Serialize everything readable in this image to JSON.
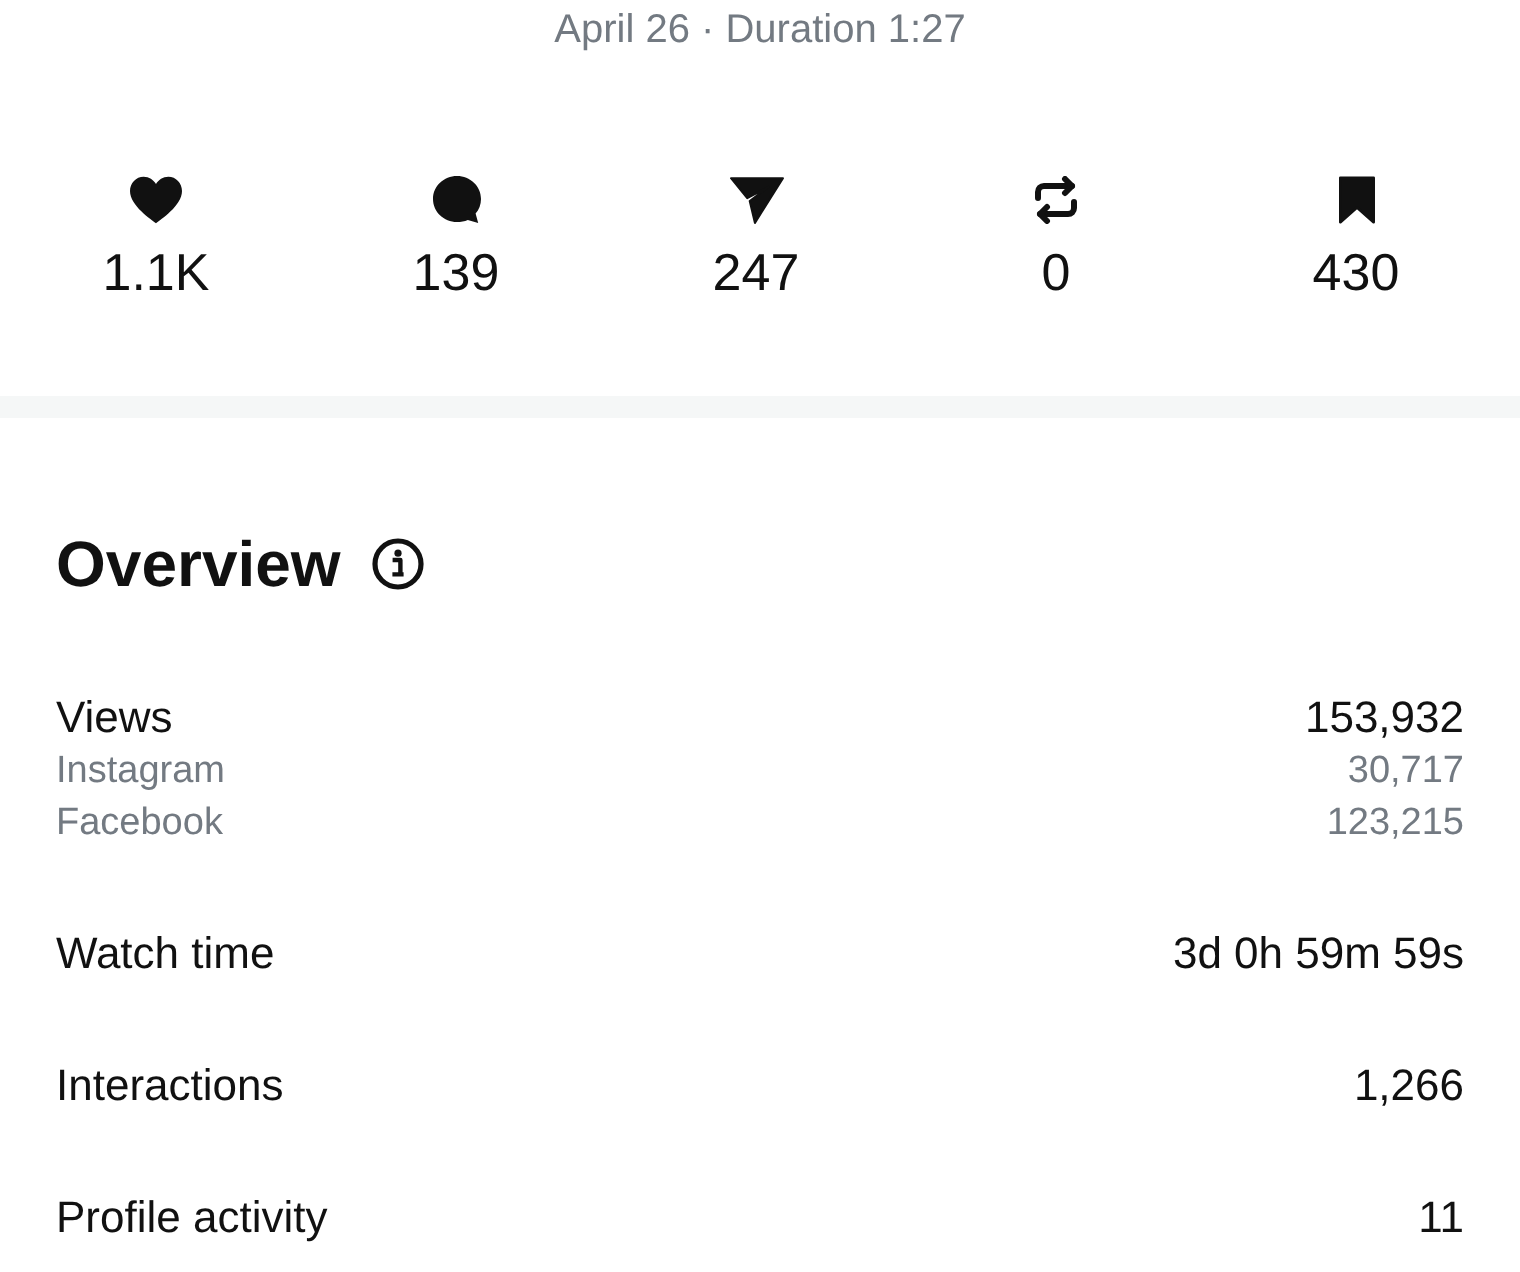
{
  "header": {
    "date_line": "April 26 · Duration 1:27"
  },
  "stats": [
    {
      "kind": "heart",
      "value": "1.1K"
    },
    {
      "kind": "comment",
      "value": "139"
    },
    {
      "kind": "send",
      "value": "247"
    },
    {
      "kind": "repost",
      "value": "0"
    },
    {
      "kind": "bookmark",
      "value": "430"
    }
  ],
  "overview": {
    "title": "Overview",
    "metrics": [
      {
        "label": "Views",
        "value": "153,932",
        "breakdown": [
          {
            "label": "Instagram",
            "value": "30,717"
          },
          {
            "label": "Facebook",
            "value": "123,215"
          }
        ]
      },
      {
        "label": "Watch time",
        "value": "3d 0h 59m 59s"
      },
      {
        "label": "Interactions",
        "value": "1,266"
      },
      {
        "label": "Profile activity",
        "value": "11"
      }
    ]
  }
}
